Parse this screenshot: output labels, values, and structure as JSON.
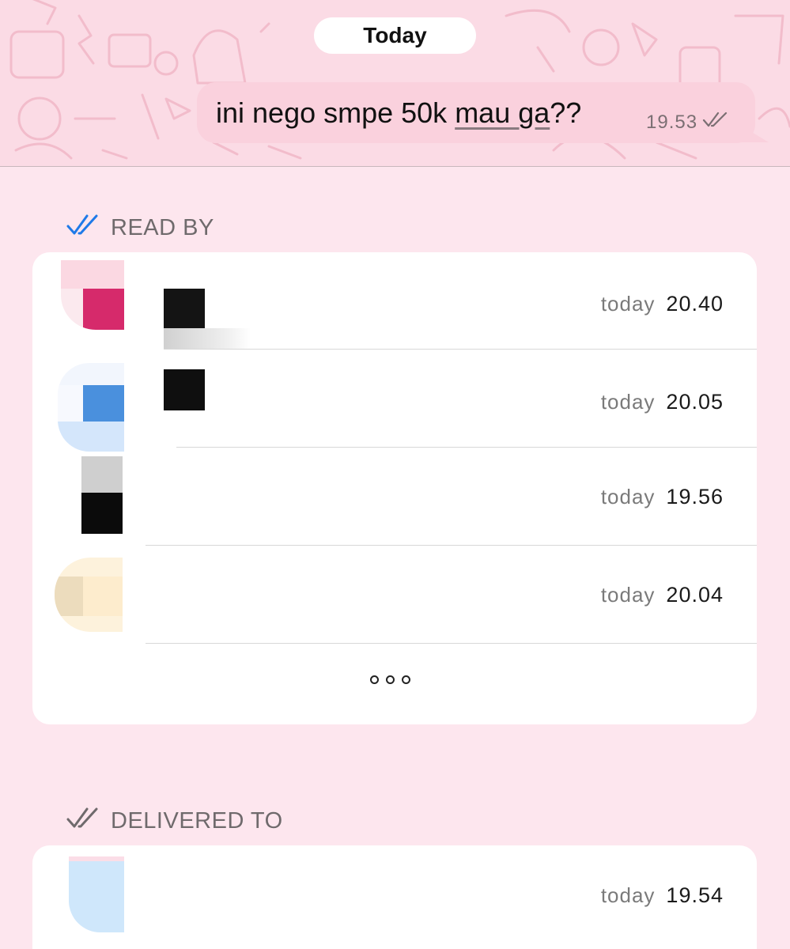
{
  "chat": {
    "date_label": "Today",
    "message": {
      "text_before": "ini nego smpe 50k ",
      "text_underlined": "mau ga",
      "text_after": "??",
      "time": "19.53",
      "status_icon": "double-check-icon"
    }
  },
  "read_by": {
    "header": "READ BY",
    "icon": "double-check-blue-icon",
    "accent": "#1f7ae8",
    "rows": [
      {
        "day": "today",
        "time": "20.40"
      },
      {
        "day": "today",
        "time": "20.05"
      },
      {
        "day": "today",
        "time": "19.56"
      },
      {
        "day": "today",
        "time": "20.04"
      }
    ],
    "more_icon": "ellipsis-icon"
  },
  "delivered_to": {
    "header": "DELIVERED TO",
    "icon": "double-check-gray-icon",
    "rows": [
      {
        "day": "today",
        "time": "19.54"
      }
    ]
  },
  "colors": {
    "background": "#fde6ee",
    "bubble": "#fad1dd",
    "card": "#ffffff"
  }
}
